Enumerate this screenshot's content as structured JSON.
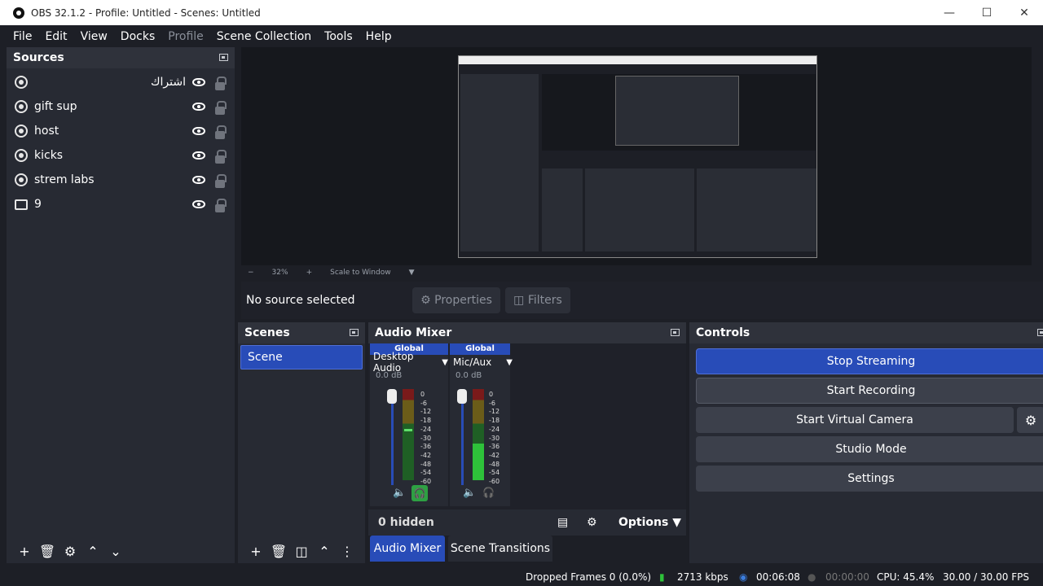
{
  "window": {
    "title": "OBS 32.1.2 - Profile: Untitled - Scenes: Untitled"
  },
  "menu": [
    "File",
    "Edit",
    "View",
    "Docks",
    "Profile",
    "Scene Collection",
    "Tools",
    "Help"
  ],
  "sources": {
    "title": "Sources",
    "items": [
      {
        "label": "اشتراك",
        "icon": "browser-icon"
      },
      {
        "label": "gift sup",
        "icon": "browser-icon"
      },
      {
        "label": "host",
        "icon": "browser-icon"
      },
      {
        "label": "kicks",
        "icon": "browser-icon"
      },
      {
        "label": "strem labs",
        "icon": "browser-icon"
      },
      {
        "label": "9",
        "icon": "monitor-icon"
      }
    ]
  },
  "preview": {
    "zoom": "32%",
    "scale_mode": "Scale to Window"
  },
  "properties_bar": {
    "status": "No source selected",
    "properties": "Properties",
    "filters": "Filters"
  },
  "scenes": {
    "title": "Scenes",
    "items": [
      "Scene"
    ]
  },
  "audio_mixer": {
    "title": "Audio Mixer",
    "channels": [
      {
        "badge": "Global",
        "name": "Desktop Audio",
        "db": "0.0 dB"
      },
      {
        "badge": "Global",
        "name": "Mic/Aux",
        "db": "0.0 dB"
      }
    ],
    "scale": [
      "0",
      "-6",
      "-12",
      "-18",
      "-24",
      "-30",
      "-36",
      "-42",
      "-48",
      "-54",
      "-60"
    ],
    "hidden": "0 hidden",
    "options": "Options"
  },
  "bottom_tabs": [
    "Audio Mixer",
    "Scene Transitions"
  ],
  "controls": {
    "title": "Controls",
    "stop_streaming": "Stop Streaming",
    "start_recording": "Start Recording",
    "start_virtual_camera": "Start Virtual Camera",
    "studio_mode": "Studio Mode",
    "settings": "Settings"
  },
  "status": {
    "dropped": "Dropped Frames 0 (0.0%)",
    "bitrate": "2713 kbps",
    "stream_time": "00:06:08",
    "rec_time": "00:00:00",
    "cpu": "CPU: 45.4%",
    "fps": "30.00 / 30.00 FPS"
  },
  "colors": {
    "accent": "#284cb8",
    "monitor_green": "#2ea043"
  }
}
